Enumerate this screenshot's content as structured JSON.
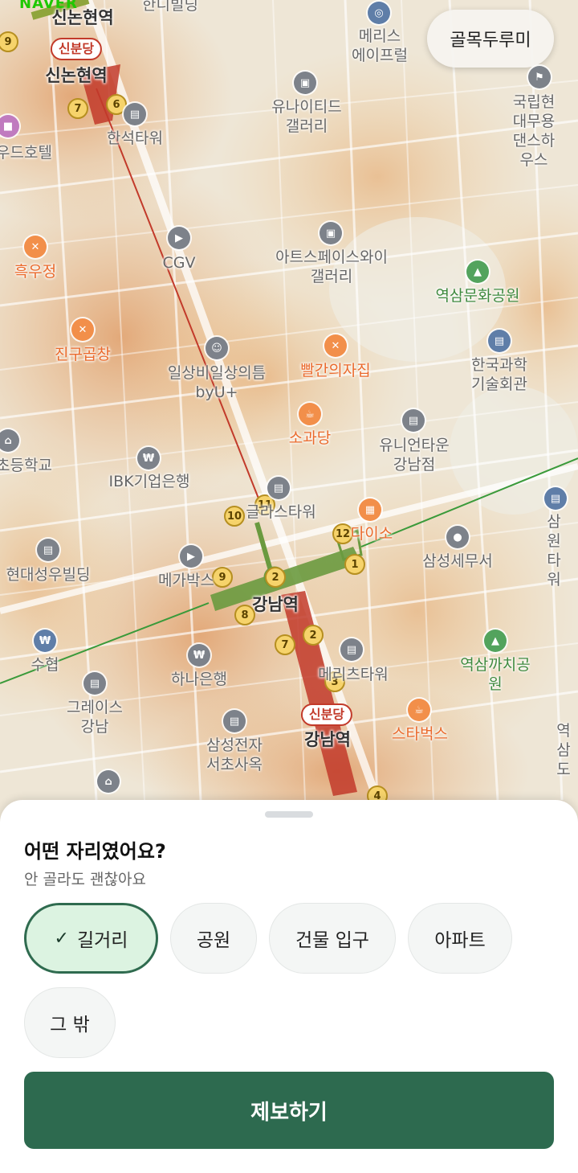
{
  "brand": {
    "text": "NAVER"
  },
  "map": {
    "alley_button": "골목두루미",
    "stations": {
      "sinnonhyeon_top": "신논현역",
      "sinnonhyeon": "신논현역",
      "gangnam_line2": "강남역",
      "gangnam_sinbundang": "강남역",
      "sinbundang_tag_top": "신분당",
      "sinbundang_tag_bottom": "신분당"
    },
    "places": {
      "merys": "메리스\n에이프럴",
      "united_gallery": "유나이티드\n갤러리",
      "national_dance": "국립현대무용\n댄스하우스",
      "hanseok_tower": "한석타워",
      "wood_hotel": "우드호텔",
      "cgv": "CGV",
      "artspace": "아트스페이스와이\n갤러리",
      "yeoksam_park": "역삼문화공원",
      "heukujeong": "흑우정",
      "jingu": "진구곱창",
      "ilsang": "일상비일상의틈\nbyU+",
      "ppalgan": "빨간의자집",
      "science_hall": "한국과학\n기술회관",
      "sogwadang": "소과당",
      "unicorn_town": "유니언타운\n강남점",
      "school": "초등학교",
      "ibk": "IBK기업은행",
      "glass_tower": "글라스타워",
      "samwon": "삼원타워",
      "daiso": "다이소",
      "samsung_tax": "삼성세무서",
      "hyundai_building": "현대성우빌딩",
      "megabox": "메가박스",
      "suhyup": "수협",
      "hana": "하나은행",
      "meritz": "메리츠타워",
      "yeoksam_kkachi": "역삼까치공원",
      "grace": "그레이스\n강남",
      "starbucks": "스타벅스",
      "samsung_seocho": "삼성전자\n서초사옥",
      "yeoksam_right": "역삼\n도",
      "handi": "한디빌딩"
    },
    "exit_numbers": [
      "9",
      "7",
      "6",
      "10",
      "11",
      "12",
      "1",
      "9",
      "2",
      "8",
      "7",
      "2",
      "3",
      "4"
    ]
  },
  "sheet": {
    "title": "어떤 자리였어요?",
    "subtitle": "안 골라도 괜찮아요",
    "options": [
      {
        "label": "길거리",
        "selected": true
      },
      {
        "label": "공원",
        "selected": false
      },
      {
        "label": "건물 입구",
        "selected": false
      },
      {
        "label": "아파트",
        "selected": false
      },
      {
        "label": "그 밖",
        "selected": false
      }
    ],
    "check_icon": "check-icon",
    "submit_label": "제보하기"
  },
  "colors": {
    "accent": "#2d6a4f",
    "chip_selected_bg": "#dcf3e1",
    "line2": "#6a9a3f",
    "sinbundang": "#c23a2a"
  }
}
